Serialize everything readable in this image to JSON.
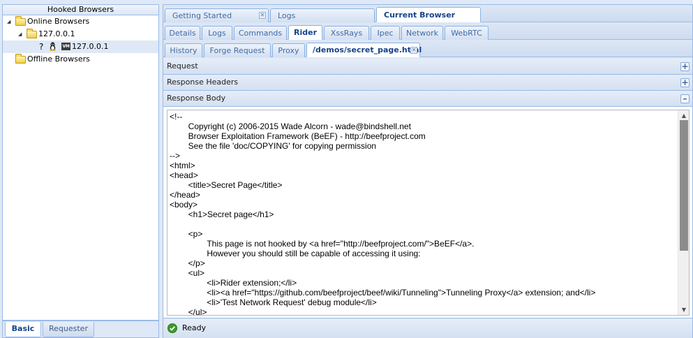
{
  "left_panel": {
    "title": "Hooked Browsers",
    "tree": {
      "online": "Online Browsers",
      "host": "127.0.0.1",
      "browser_unknown_marker": "?",
      "vm_badge": "VM",
      "browser": "127.0.0.1",
      "offline": "Offline Browsers"
    },
    "bottom_tabs": [
      "Basic",
      "Requester"
    ]
  },
  "main_tabs": {
    "getting_started": "Getting Started",
    "logs": "Logs",
    "current_browser": "Current Browser"
  },
  "browser_tabs": [
    "Details",
    "Logs",
    "Commands",
    "Rider",
    "XssRays",
    "Ipec",
    "Network",
    "WebRTC"
  ],
  "rider_tabs": {
    "history": "History",
    "forge_request": "Forge Request",
    "proxy": "Proxy",
    "page": "/demos/secret_page.html"
  },
  "sections": {
    "request": "Request",
    "response_headers": "Response Headers",
    "response_body": "Response Body"
  },
  "response_body": "<!--\n\tCopyright (c) 2006-2015 Wade Alcorn - wade@bindshell.net\n\tBrowser Exploitation Framework (BeEF) - http://beefproject.com\n\tSee the file 'doc/COPYING' for copying permission\n-->\n<html>\n<head>\n\t<title>Secret Page</title>\n</head>\n<body>\n\t<h1>Secret page</h1>\n\n\t<p>\n\t\tThis page is not hooked by <a href=\"http://beefproject.com/\">BeEF</a>.\n\t\tHowever you should still be capable of accessing it using:\n\t</p>\n\t<ul>\n\t\t<li>Rider extension;</li>\n\t\t<li><a href=\"https://github.com/beefproject/beef/wiki/Tunneling\">Tunneling Proxy</a> extension; and</li>\n\t\t<li>'Test Network Request' debug module</li>\n\t</ul>",
  "status": {
    "text": "Ready",
    "icon": "check-icon"
  },
  "icons": {
    "expand": "triangle-down-icon",
    "folder": "folder-icon",
    "os": "linux-icon",
    "close": "close-icon",
    "expand_section": "plus-icon",
    "collapse_section": "minus-icon"
  },
  "colors": {
    "border": "#99bbe8",
    "active_tab_text": "#15428b",
    "inactive_tab_text": "#416aa3",
    "panel_bg": "#dfe8f6",
    "status_ok": "#3c9a2e"
  }
}
